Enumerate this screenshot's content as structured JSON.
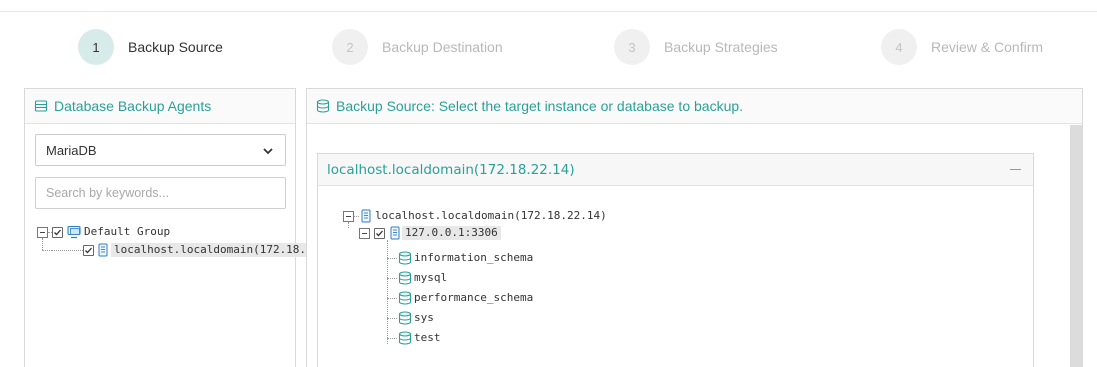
{
  "steps": [
    {
      "num": "1",
      "label": "Backup Source",
      "state": "active"
    },
    {
      "num": "2",
      "label": "Backup Destination",
      "state": "inactive"
    },
    {
      "num": "3",
      "label": "Backup Strategies",
      "state": "inactive"
    },
    {
      "num": "4",
      "label": "Review & Confirm",
      "state": "inactive"
    }
  ],
  "left_panel": {
    "title": "Database Backup Agents",
    "select_value": "MariaDB",
    "search_placeholder": "Search by keywords...",
    "tree": {
      "group_label": "Default Group",
      "host_label": "localhost.localdomain(172.18."
    }
  },
  "right_panel": {
    "title": "Backup Source: Select the target instance or database to backup.",
    "instance": {
      "header": "localhost.localdomain(172.18.22.14)",
      "root_label": "localhost.localdomain(172.18.22.14)",
      "port_label": "127.0.0.1:3306",
      "databases": [
        "information_schema",
        "mysql",
        "performance_schema",
        "sys",
        "test"
      ]
    }
  },
  "colors": {
    "accent": "#2aa198",
    "active_step_bg": "#d7ecea",
    "inactive_step_bg": "#f0f0f0"
  }
}
